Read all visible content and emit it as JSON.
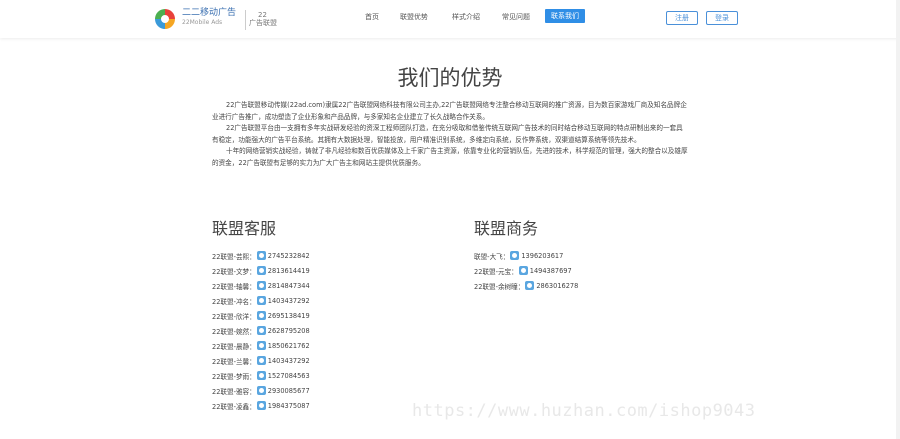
{
  "brand": {
    "name": "二二移动广告",
    "name_en": "22Mobile Ads",
    "sub_line1": "22",
    "sub_line2": "广告联盟"
  },
  "nav": {
    "items": [
      {
        "label": "首页"
      },
      {
        "label": "联盟优势"
      },
      {
        "label": "样式介绍"
      },
      {
        "label": "常见问题"
      },
      {
        "label": "联系我们",
        "active": true
      }
    ],
    "register_label": "注册",
    "login_label": "登录"
  },
  "page": {
    "title": "我们的优势",
    "paragraphs": [
      "22广告联盟移动传媒(22ad.com)隶属22广告联盟网络科技有限公司主办,22广告联盟网络专注整合移动互联网的推广资源，目为数百家游戏厂商及知名品牌企业进行广告推广，成功塑造了企业形象和产品品牌，与多家知名企业建立了长久战略合作关系。",
      "22广告联盟平台由一支拥有多年实战研发经验的资深工程师团队打造，在充分吸取和借鉴传统互联网广告技术的同时结合移动互联网的特点研制出来的一套具有稳定，功能强大的广告平台系统。其拥有大数据处理，智能投放，用户精准识别系统，多维定向系统，反作弊系统，双渠道结算系统等领先技术。",
      "十年的网络营销实战经验，铸就了非凡经验和数百优质媒体及上千家广告主资源，依靠专业化的营销队伍，先进的技术，科学规范的管理，强大的整合以及雄厚的资金，22广告联盟有足够的实力为广大广告主和网站主提供优质服务。"
    ]
  },
  "service": {
    "title": "联盟客服",
    "contacts": [
      {
        "name": "22联盟-芸熙：",
        "qq": "2745232842"
      },
      {
        "name": "22联盟-文梦：",
        "qq": "2813614419"
      },
      {
        "name": "22联盟-轴馨：",
        "qq": "2814847344"
      },
      {
        "name": "22联盟-冲名：",
        "qq": "1403437292"
      },
      {
        "name": "22联盟-欣洋：",
        "qq": "2695138419"
      },
      {
        "name": "22联盟-婉然：",
        "qq": "2628795208"
      },
      {
        "name": "22联盟-晨静：",
        "qq": "1850621762"
      },
      {
        "name": "22联盟-兰馨：",
        "qq": "1403437292"
      },
      {
        "name": "22联盟-梦雨：",
        "qq": "1527084563"
      },
      {
        "name": "22联盟-雅容：",
        "qq": "2930085677"
      },
      {
        "name": "22联盟-凌鑫：",
        "qq": "1984375087"
      }
    ]
  },
  "business": {
    "title": "联盟商务",
    "contacts": [
      {
        "name": "联盟-大飞：",
        "qq": "1396203617"
      },
      {
        "name": "22联盟-元宝：",
        "qq": "1494387697"
      },
      {
        "name": "22联盟-余树瞳：",
        "qq": "2863016278"
      }
    ]
  },
  "watermark": "https://www.huzhan.com/ishop9043",
  "colors": {
    "accent": "#2f8ee6",
    "text": "#444444"
  }
}
